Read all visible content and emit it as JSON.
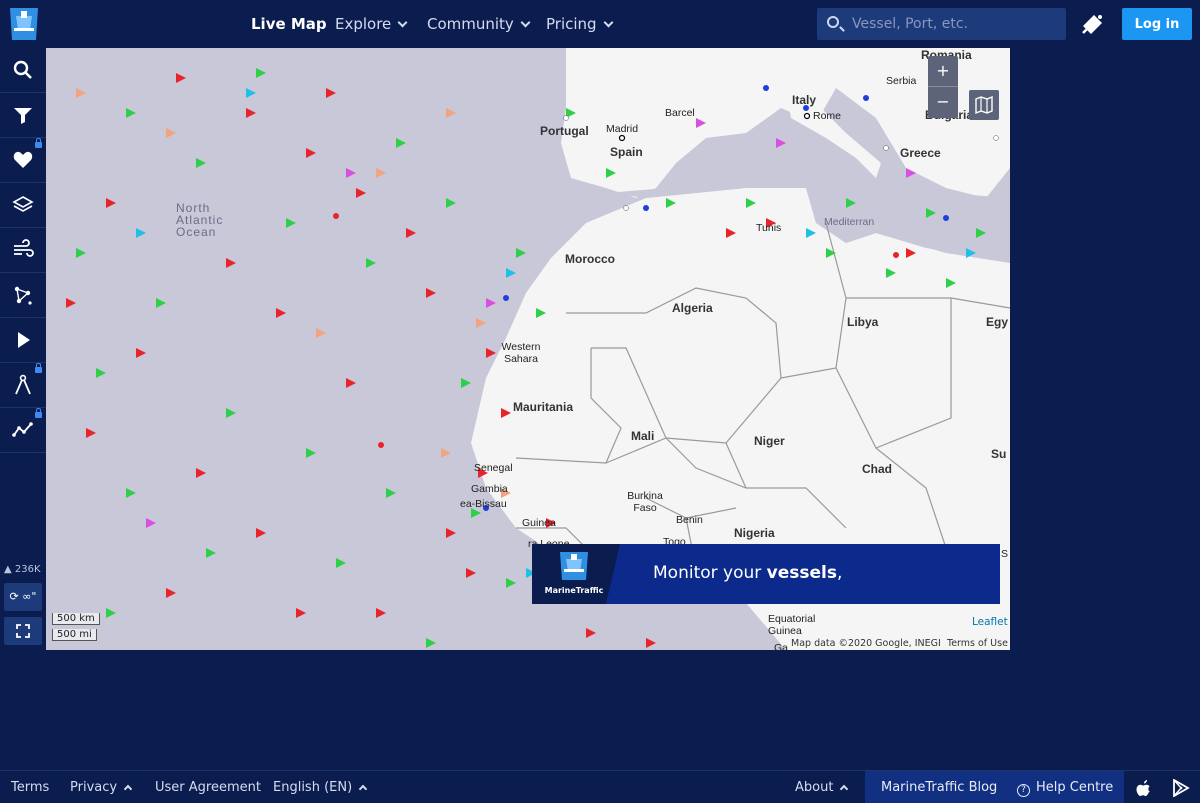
{
  "nav": {
    "logo_icon": "marinetraffic-logo-icon",
    "items": [
      {
        "label": "Live Map",
        "active": true
      },
      {
        "label": "Explore"
      },
      {
        "label": "Community"
      },
      {
        "label": "Pricing"
      }
    ],
    "search_placeholder": "Vessel, Port, etc.",
    "login_label": "Log in"
  },
  "sidebar": {
    "buttons": [
      {
        "icon": "search-icon"
      },
      {
        "icon": "filter-icon"
      },
      {
        "icon": "heart-icon",
        "locked": true
      },
      {
        "icon": "layers-icon"
      },
      {
        "icon": "wind-icon"
      },
      {
        "icon": "network-icon"
      },
      {
        "icon": "play-icon"
      },
      {
        "icon": "route-icon",
        "locked": true
      },
      {
        "icon": "analytics-icon",
        "locked": true
      }
    ],
    "vessel_count": "236K",
    "refresh_label": "∞\"",
    "fullscreen_icon": "fullscreen-icon"
  },
  "map": {
    "labels": {
      "romania": "Romania",
      "serbia": "Serbia",
      "bulgaria": "Bulgaria",
      "italy": "Italy",
      "rome": "Rome",
      "greece": "Greece",
      "madrid": "Madrid",
      "spain": "Spain",
      "barcelona": "Barcel",
      "portugal": "Portugal",
      "tunis": "Tunis",
      "mediterranean": "Mediterran",
      "morocco": "Morocco",
      "algeria": "Algeria",
      "libya": "Libya",
      "egypt": "Egy",
      "western_sahara": "Western Sahara",
      "mauritania": "Mauritania",
      "mali": "Mali",
      "niger": "Niger",
      "chad": "Chad",
      "sudan": "Su",
      "senegal": "Senegal",
      "gambia": "Gambia",
      "guinea_bissau": "ea-Bissau",
      "guinea": "Guinea",
      "burkina_faso": "Burkina Faso",
      "benin": "Benin",
      "togo": "Togo",
      "nigeria": "Nigeria",
      "sierra_leone": "ra Leone",
      "equatorial_guinea": "Equatorial Guinea",
      "ocean_line1": "North",
      "ocean_line2": "Atlantic",
      "ocean_line3": "Ocean",
      "south_partial": "S",
      "gabon_partial": "Ga"
    },
    "zoom_in": "+",
    "zoom_out": "−",
    "scale_km": "500 km",
    "scale_mi": "500 mi",
    "attribution": "Map data ©2020 Google, INEGI",
    "terms": "Terms of Use",
    "leaflet": "Leaflet"
  },
  "banner": {
    "brand": "MarineTraffic",
    "headline_pre": "Monitor your ",
    "headline_bold": "vessels",
    "headline_post": ","
  },
  "footer": {
    "terms": "Terms",
    "privacy": "Privacy",
    "user_agreement": "User Agreement",
    "language": "English (EN)",
    "about": "About",
    "blog": "MarineTraffic Blog",
    "help": "Help Centre",
    "apple_icon": "apple-icon",
    "play_icon": "google-play-icon"
  },
  "colors": {
    "navy": "#0b1d4f",
    "accent_blue": "#1b96f3",
    "ocean": "#c9c8d9",
    "land": "#f5f5f5"
  }
}
